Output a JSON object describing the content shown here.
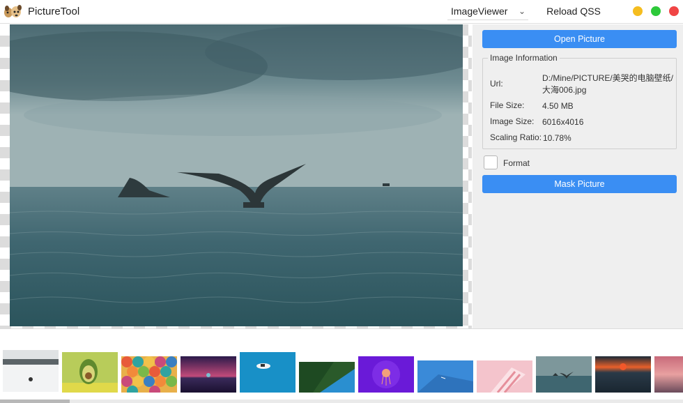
{
  "app": {
    "title": "PictureTool"
  },
  "toolbar": {
    "mode_value": "ImageViewer",
    "reload_label": "Reload QSS"
  },
  "panel": {
    "open_button": "Open Picture",
    "group_title": "Image Information",
    "url_label": "Url:",
    "url_value_line1": "D:/Mine/PICTURE/美哭的电脑壁纸/",
    "url_value_line2": "大海006.jpg",
    "file_size_label": "File Size:",
    "file_size_value": "4.50 MB",
    "image_size_label": "Image Size:",
    "image_size_value": "6016x4016",
    "scaling_label": "Scaling Ratio:",
    "scaling_value": "10.78%",
    "format_label": "Format",
    "format_checked": false,
    "mask_button": "Mask Picture"
  },
  "colors": {
    "accent": "#3a8ef3",
    "minimize": "#f5bd1f",
    "maximize": "#2dc93a",
    "close": "#f04545"
  },
  "thumbnails": [
    {
      "name": "snowy-landscape"
    },
    {
      "name": "avocado-toy"
    },
    {
      "name": "colorful-scales"
    },
    {
      "name": "purple-sunset"
    },
    {
      "name": "boat-blue-sea"
    },
    {
      "name": "forest-aerial"
    },
    {
      "name": "jellyfish"
    },
    {
      "name": "ocean-shadow"
    },
    {
      "name": "pink-abstract"
    },
    {
      "name": "whale-tail"
    },
    {
      "name": "orange-sunset"
    },
    {
      "name": "sunset-partial"
    }
  ],
  "scroll": {
    "position_fraction": 0.0
  }
}
